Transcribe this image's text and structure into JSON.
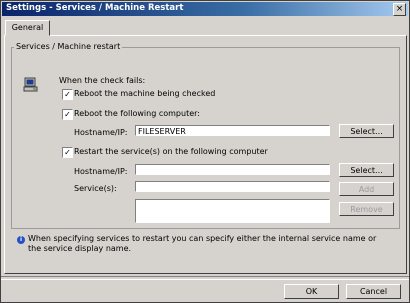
{
  "window": {
    "title": "Settings - Services / Machine Restart",
    "close_glyph": "×"
  },
  "tabs": [
    {
      "label": "General"
    }
  ],
  "group": {
    "label": "Services / Machine restart",
    "when_check_fails": "When the check fails:",
    "option_reboot_checked": {
      "label": "Reboot the machine being checked",
      "checked": true
    },
    "option_reboot_following": {
      "label": "Reboot the following computer:",
      "checked": true
    },
    "hostname_label_1": "Hostname/IP:",
    "hostname_value_1": "FILESERVER",
    "select_button_1": "Select...",
    "option_restart_services": {
      "label": "Restart the service(s) on the following computer",
      "checked": true
    },
    "hostname_label_2": "Hostname/IP:",
    "hostname_value_2": "",
    "select_button_2": "Select...",
    "services_label": "Service(s):",
    "services_value": "",
    "add_button": "Add",
    "remove_button": "Remove"
  },
  "info": {
    "icon": "info-icon",
    "text": "When specifying services to restart you can specify either the internal service name or the service display name."
  },
  "footer": {
    "ok_label": "OK",
    "cancel_label": "Cancel"
  },
  "check_glyph": "✓"
}
